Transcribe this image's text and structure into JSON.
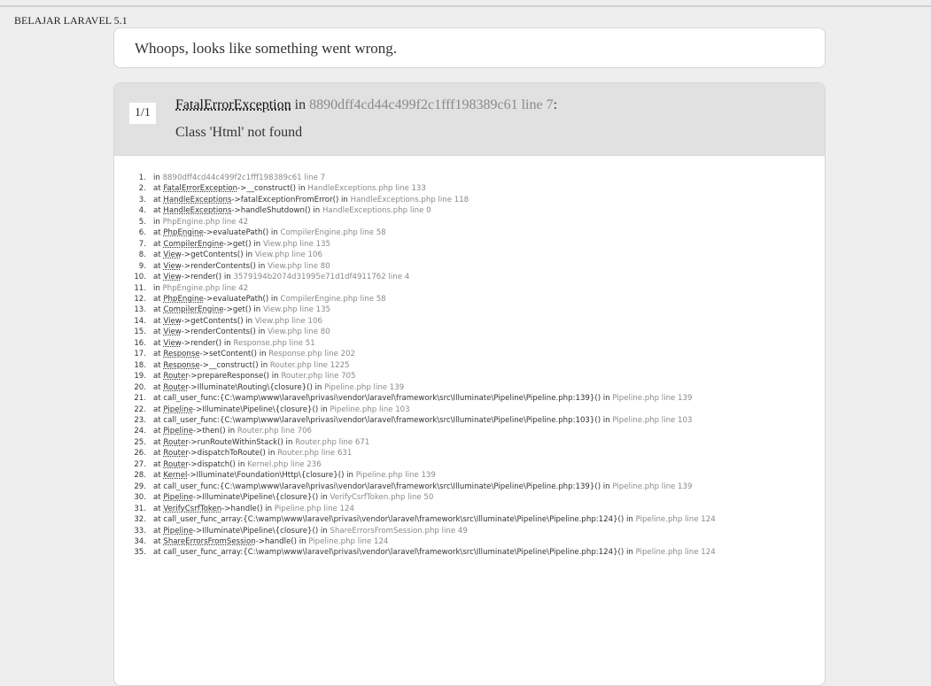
{
  "site_title": "BELAJAR LARAVEL 5.1",
  "message": "Whoops, looks like something went wrong.",
  "exception": {
    "counter": "1/1",
    "class": "FatalErrorException",
    "in_word": " in ",
    "file": "8890dff4cd44c499f2c1fff198389c61",
    "line_text": " line 7",
    "colon": ":",
    "message": "Class 'Html' not found"
  },
  "trace": [
    {
      "n": "1.",
      "at": "in",
      "cls": "",
      "call": "",
      "loc": "8890dff4cd44c499f2c1fff198389c61 line 7"
    },
    {
      "n": "2.",
      "at": "at",
      "cls": "FatalErrorException",
      "call": "->__construct() in",
      "loc": "HandleExceptions.php line 133"
    },
    {
      "n": "3.",
      "at": "at",
      "cls": "HandleExceptions",
      "call": "->fatalExceptionFromError() in",
      "loc": "HandleExceptions.php line 118"
    },
    {
      "n": "4.",
      "at": "at",
      "cls": "HandleExceptions",
      "call": "->handleShutdown() in",
      "loc": "HandleExceptions.php line 0"
    },
    {
      "n": "5.",
      "at": "in",
      "cls": "",
      "call": "",
      "loc": "PhpEngine.php line 42"
    },
    {
      "n": "6.",
      "at": "at",
      "cls": "PhpEngine",
      "call": "->evaluatePath() in",
      "loc": "CompilerEngine.php line 58"
    },
    {
      "n": "7.",
      "at": "at",
      "cls": "CompilerEngine",
      "call": "->get() in",
      "loc": "View.php line 135"
    },
    {
      "n": "8.",
      "at": "at",
      "cls": "View",
      "call": "->getContents() in",
      "loc": "View.php line 106"
    },
    {
      "n": "9.",
      "at": "at",
      "cls": "View",
      "call": "->renderContents() in",
      "loc": "View.php line 80"
    },
    {
      "n": "10.",
      "at": "at",
      "cls": "View",
      "call": "->render() in",
      "loc": "3579194b2074d31995e71d1df4911762 line 4"
    },
    {
      "n": "11.",
      "at": "in",
      "cls": "",
      "call": "",
      "loc": "PhpEngine.php line 42"
    },
    {
      "n": "12.",
      "at": "at",
      "cls": "PhpEngine",
      "call": "->evaluatePath() in",
      "loc": "CompilerEngine.php line 58"
    },
    {
      "n": "13.",
      "at": "at",
      "cls": "CompilerEngine",
      "call": "->get() in",
      "loc": "View.php line 135"
    },
    {
      "n": "14.",
      "at": "at",
      "cls": "View",
      "call": "->getContents() in",
      "loc": "View.php line 106"
    },
    {
      "n": "15.",
      "at": "at",
      "cls": "View",
      "call": "->renderContents() in",
      "loc": "View.php line 80"
    },
    {
      "n": "16.",
      "at": "at",
      "cls": "View",
      "call": "->render() in",
      "loc": "Response.php line 51"
    },
    {
      "n": "17.",
      "at": "at",
      "cls": "Response",
      "call": "->setContent() in",
      "loc": "Response.php line 202"
    },
    {
      "n": "18.",
      "at": "at",
      "cls": "Response",
      "call": "->__construct() in",
      "loc": "Router.php line 1225"
    },
    {
      "n": "19.",
      "at": "at",
      "cls": "Router",
      "call": "->prepareResponse() in",
      "loc": "Router.php line 705"
    },
    {
      "n": "20.",
      "at": "at",
      "cls": "Router",
      "call": "->Illuminate\\Routing\\{closure}() in",
      "loc": "Pipeline.php line 139"
    },
    {
      "n": "21.",
      "at": "at",
      "cls": "",
      "call": "call_user_func:{C:\\wamp\\www\\laravel\\privasi\\vendor\\laravel\\framework\\src\\Illuminate\\Pipeline\\Pipeline.php:139}() in",
      "loc": "Pipeline.php line 139"
    },
    {
      "n": "22.",
      "at": "at",
      "cls": "Pipeline",
      "call": "->Illuminate\\Pipeline\\{closure}() in",
      "loc": "Pipeline.php line 103"
    },
    {
      "n": "23.",
      "at": "at",
      "cls": "",
      "call": "call_user_func:{C:\\wamp\\www\\laravel\\privasi\\vendor\\laravel\\framework\\src\\Illuminate\\Pipeline\\Pipeline.php:103}() in",
      "loc": "Pipeline.php line 103"
    },
    {
      "n": "24.",
      "at": "at",
      "cls": "Pipeline",
      "call": "->then() in",
      "loc": "Router.php line 706"
    },
    {
      "n": "25.",
      "at": "at",
      "cls": "Router",
      "call": "->runRouteWithinStack() in",
      "loc": "Router.php line 671"
    },
    {
      "n": "26.",
      "at": "at",
      "cls": "Router",
      "call": "->dispatchToRoute() in",
      "loc": "Router.php line 631"
    },
    {
      "n": "27.",
      "at": "at",
      "cls": "Router",
      "call": "->dispatch() in",
      "loc": "Kernel.php line 236"
    },
    {
      "n": "28.",
      "at": "at",
      "cls": "Kernel",
      "call": "->Illuminate\\Foundation\\Http\\{closure}() in",
      "loc": "Pipeline.php line 139"
    },
    {
      "n": "29.",
      "at": "at",
      "cls": "",
      "call": "call_user_func:{C:\\wamp\\www\\laravel\\privasi\\vendor\\laravel\\framework\\src\\Illuminate\\Pipeline\\Pipeline.php:139}() in",
      "loc": "Pipeline.php line 139"
    },
    {
      "n": "30.",
      "at": "at",
      "cls": "Pipeline",
      "call": "->Illuminate\\Pipeline\\{closure}() in",
      "loc": "VerifyCsrfToken.php line 50"
    },
    {
      "n": "31.",
      "at": "at",
      "cls": "VerifyCsrfToken",
      "call": "->handle() in",
      "loc": "Pipeline.php line 124"
    },
    {
      "n": "32.",
      "at": "at",
      "cls": "",
      "call": "call_user_func_array:{C:\\wamp\\www\\laravel\\privasi\\vendor\\laravel\\framework\\src\\Illuminate\\Pipeline\\Pipeline.php:124}() in",
      "loc": "Pipeline.php line 124"
    },
    {
      "n": "33.",
      "at": "at",
      "cls": "Pipeline",
      "call": "->Illuminate\\Pipeline\\{closure}() in",
      "loc": "ShareErrorsFromSession.php line 49"
    },
    {
      "n": "34.",
      "at": "at",
      "cls": "ShareErrorsFromSession",
      "call": "->handle() in",
      "loc": "Pipeline.php line 124"
    },
    {
      "n": "35.",
      "at": "at",
      "cls": "",
      "call": "call_user_func_array:{C:\\wamp\\www\\laravel\\privasi\\vendor\\laravel\\framework\\src\\Illuminate\\Pipeline\\Pipeline.php:124}() in",
      "loc": "Pipeline.php line 124"
    }
  ]
}
